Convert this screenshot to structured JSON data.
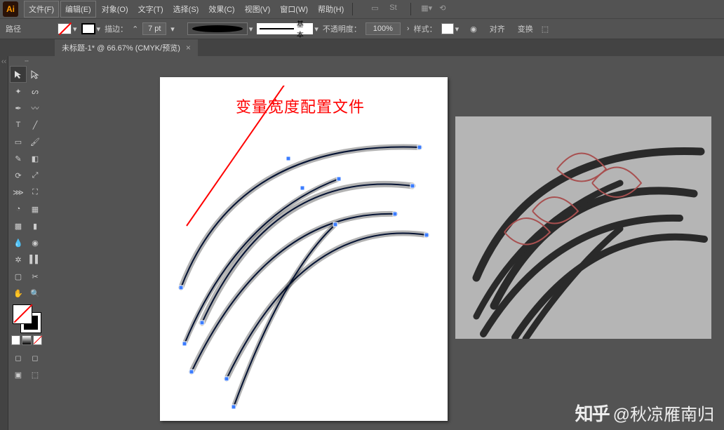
{
  "app": {
    "logo": "Ai"
  },
  "menu": {
    "file": "文件(F)",
    "edit": "编辑(E)",
    "object": "对象(O)",
    "text": "文字(T)",
    "select": "选择(S)",
    "effect": "效果(C)",
    "view": "视图(V)",
    "window": "窗口(W)",
    "help": "帮助(H)"
  },
  "options": {
    "selection": "路径",
    "stroke_label": "描边：",
    "stroke_weight": "7 pt",
    "brush_label": "基本",
    "opacity_label": "不透明度：",
    "opacity_value": "100%",
    "style_label": "样式：",
    "align_label": "对齐",
    "transform_label": "变换"
  },
  "tab": {
    "title": "未标题-1* @ 66.67% (CMYK/预览)"
  },
  "annotation": {
    "text": "变量宽度配置文件"
  },
  "watermark": {
    "brand": "知乎",
    "author": "@秋凉雁南归"
  }
}
